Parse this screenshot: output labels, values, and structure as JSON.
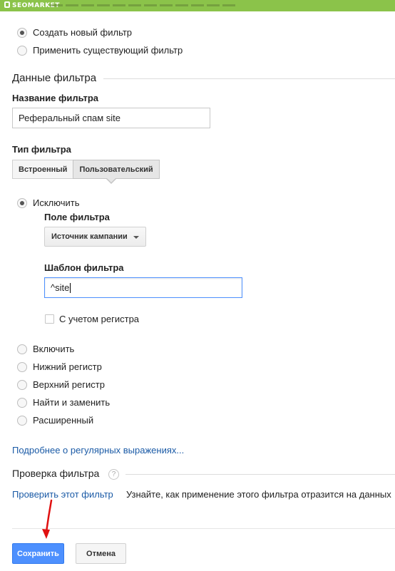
{
  "brand": {
    "name": "SEOMARKET"
  },
  "filter_mode": {
    "options": [
      {
        "label": "Создать новый фильтр",
        "checked": true
      },
      {
        "label": "Применить существующий фильтр",
        "checked": false
      }
    ]
  },
  "filter_data": {
    "section_title": "Данные фильтра",
    "name_label": "Название фильтра",
    "name_value": "Реферальный спам site",
    "type_label": "Тип фильтра",
    "tabs": [
      {
        "label": "Встроенный",
        "active": false
      },
      {
        "label": "Пользовательский",
        "active": true
      }
    ],
    "exclude": {
      "label": "Исключить",
      "checked": true,
      "field_label": "Поле фильтра",
      "field_value": "Источник кампании",
      "pattern_label": "Шаблон фильтра",
      "pattern_value": "^site",
      "case_label": "С учетом регистра",
      "case_checked": false
    },
    "other_types": [
      {
        "label": "Включить"
      },
      {
        "label": "Нижний регистр"
      },
      {
        "label": "Верхний регистр"
      },
      {
        "label": "Найти и заменить"
      },
      {
        "label": "Расширенный"
      }
    ],
    "regex_link": "Подробнее о регулярных выражениях..."
  },
  "verify": {
    "section_title": "Проверка фильтра",
    "help": "?",
    "link": "Проверить этот фильтр",
    "description": "Узнайте, как применение этого фильтра отразится на данных"
  },
  "actions": {
    "save": "Сохранить",
    "cancel": "Отмена"
  },
  "annotation_color": "#e01010"
}
